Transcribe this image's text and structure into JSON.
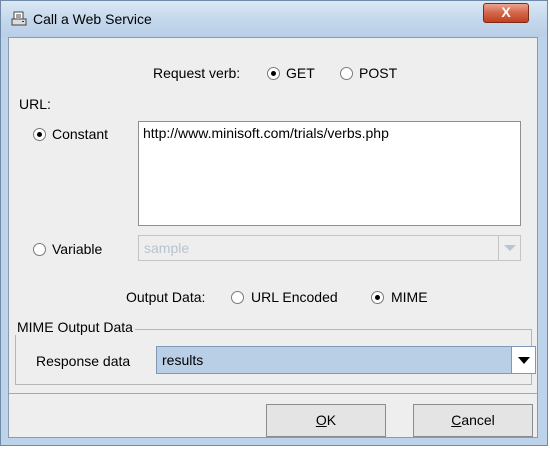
{
  "window": {
    "title": "Call a Web Service",
    "close_label": "X"
  },
  "request_verb": {
    "label": "Request verb:",
    "options": [
      "GET",
      "POST"
    ],
    "selected": "GET"
  },
  "url": {
    "section_label": "URL:",
    "constant_label": "Constant",
    "constant_value": "http://www.minisoft.com/trials/verbs.php",
    "variable_label": "Variable",
    "variable_value": "sample",
    "selected": "Constant"
  },
  "output_data": {
    "label": "Output Data:",
    "options": [
      "URL Encoded",
      "MIME"
    ],
    "selected": "MIME"
  },
  "mime_group": {
    "title": "MIME Output Data",
    "response_label": "Response data",
    "response_value": "results"
  },
  "buttons": {
    "ok_mnemonic": "O",
    "ok_rest": "K",
    "cancel_mnemonic": "C",
    "cancel_rest": "ancel"
  },
  "colors": {
    "titlebar": "#c5d8ec",
    "dialog_bg": "#eeeeee",
    "close_button": "#c2401f",
    "selected_combo": "#b8cfe5"
  },
  "icons": {
    "app": "printer-page-icon",
    "close": "close-icon",
    "dropdown": "chevron-down-icon"
  }
}
